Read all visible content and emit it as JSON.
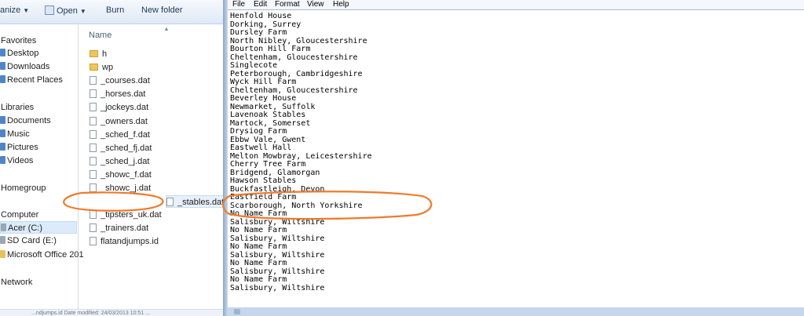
{
  "explorer": {
    "toolbar": {
      "organize": "anize",
      "open": "Open",
      "burn": "Burn",
      "new_folder": "New folder"
    },
    "nav": {
      "favorites": "Favorites",
      "desktop": "Desktop",
      "downloads": "Downloads",
      "recent_places": "Recent Places",
      "libraries": "Libraries",
      "documents": "Documents",
      "music": "Music",
      "pictures": "Pictures",
      "videos": "Videos",
      "homegroup": "Homegroup",
      "computer": "Computer",
      "acer": "Acer (C:)",
      "sdcard": "SD Card (E:)",
      "msoffice": "Microsoft Office 201",
      "network": "Network"
    },
    "column_header": "Name",
    "files": [
      {
        "name": "h",
        "type": "folder"
      },
      {
        "name": "wp",
        "type": "folder"
      },
      {
        "name": "_courses.dat",
        "type": "file"
      },
      {
        "name": "_horses.dat",
        "type": "file"
      },
      {
        "name": "_jockeys.dat",
        "type": "file"
      },
      {
        "name": "_owners.dat",
        "type": "file"
      },
      {
        "name": "_sched_f.dat",
        "type": "file"
      },
      {
        "name": "_sched_fj.dat",
        "type": "file"
      },
      {
        "name": "_sched_j.dat",
        "type": "file"
      },
      {
        "name": "_showc_f.dat",
        "type": "file"
      },
      {
        "name": "_showc_j.dat",
        "type": "file"
      },
      {
        "name": "_stables.dat",
        "type": "file",
        "selected": true
      },
      {
        "name": "_tipsters_uk.dat",
        "type": "file"
      },
      {
        "name": "_trainers.dat",
        "type": "file"
      },
      {
        "name": "flatandjumps.id",
        "type": "file"
      }
    ],
    "status_text": "...ndjumps.id  Date modified: 24/03/2013 10:51 ..."
  },
  "notepad": {
    "menu": [
      "File",
      "Edit",
      "Format",
      "View",
      "Help"
    ],
    "lines": [
      "Henfold House",
      "Dorking, Surrey",
      "Dursley Farm",
      "North Nibley, Gloucestershire",
      "Bourton Hill Farm",
      "Cheltenham, Gloucestershire",
      "Singlecote",
      "Peterborough, Cambridgeshire",
      "Wyck Hill Farm",
      "Cheltenham, Gloucestershire",
      "Beverley House",
      "Newmarket, Suffolk",
      "Lavenoak Stables",
      "Martock, Somerset",
      "Drysiog Farm",
      "Ebbw Vale, Gwent",
      "Eastwell Hall",
      "Melton Mowbray, Leicestershire",
      "Cherry Tree Farm",
      "Bridgend, Glamorgan",
      "Hawson Stables",
      "Buckfastleigh, Devon",
      "Eastfield Farm",
      "Scarborough, North Yorkshire",
      "No Name Farm",
      "Salisbury, Wiltshire",
      "No Name Farm",
      "Salisbury, Wiltshire",
      "No Name Farm",
      "Salisbury, Wiltshire",
      "No Name Farm",
      "Salisbury, Wiltshire",
      "No Name Farm",
      "Salisbury, Wiltshire"
    ]
  },
  "colors": {
    "annotation": "#f07a2a",
    "selection": "#dcebfc"
  }
}
